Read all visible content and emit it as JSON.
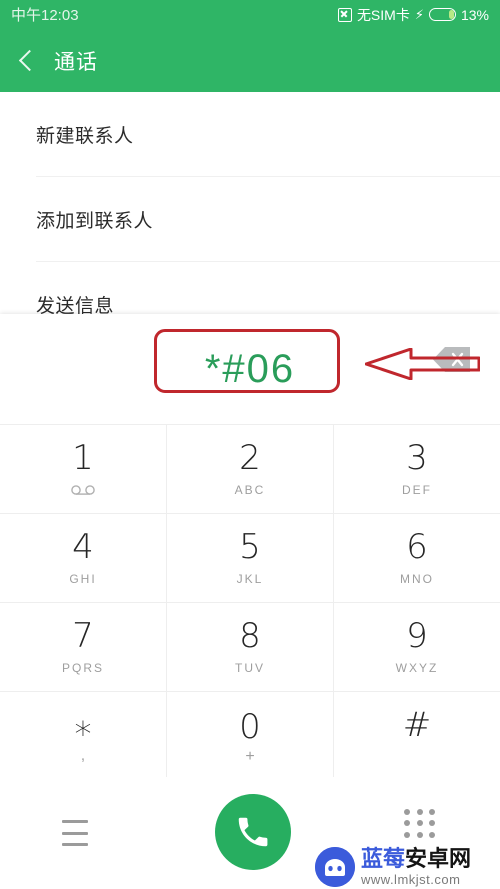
{
  "status_bar": {
    "time": "中午12:03",
    "sim_icon": "sim-card-disabled-icon",
    "sim_text": "无SIM卡",
    "charging_icon": "lightning-bolt-icon",
    "battery_percent": "13%",
    "battery_level": 13
  },
  "header": {
    "back_icon": "chevron-left-icon",
    "title": "通话",
    "background_color": "#2fb566"
  },
  "menu": {
    "items": [
      {
        "label": "新建联系人"
      },
      {
        "label": "添加到联系人"
      },
      {
        "label": "发送信息"
      }
    ]
  },
  "dialer": {
    "number": "*#06",
    "number_color": "#2a9d5a",
    "backspace_icon": "backspace-delete-icon",
    "keys": [
      {
        "digit": "1",
        "sub": "",
        "sub_icon": "voicemail-icon"
      },
      {
        "digit": "2",
        "sub": "ABC",
        "sub_icon": ""
      },
      {
        "digit": "3",
        "sub": "DEF",
        "sub_icon": ""
      },
      {
        "digit": "4",
        "sub": "GHI",
        "sub_icon": ""
      },
      {
        "digit": "5",
        "sub": "JKL",
        "sub_icon": ""
      },
      {
        "digit": "6",
        "sub": "MNO",
        "sub_icon": ""
      },
      {
        "digit": "7",
        "sub": "PQRS",
        "sub_icon": ""
      },
      {
        "digit": "8",
        "sub": "TUV",
        "sub_icon": ""
      },
      {
        "digit": "9",
        "sub": "WXYZ",
        "sub_icon": ""
      },
      {
        "digit": "∗",
        "sub": ",",
        "sub_icon": ""
      },
      {
        "digit": "0",
        "sub": "+",
        "sub_icon": ""
      },
      {
        "digit": "#",
        "sub": "",
        "sub_icon": ""
      }
    ]
  },
  "bottom_bar": {
    "menu_icon": "hamburger-menu-icon",
    "call_icon": "phone-handset-icon",
    "call_button_color": "#27ae60",
    "keypad_icon": "keypad-dots-icon"
  },
  "annotations": {
    "highlight_box_color": "#c0272d",
    "arrow_color": "#c0272d",
    "arrow_target": "backspace-delete-icon"
  },
  "watermark": {
    "logo_icon": "android-robot-logo-icon",
    "name_blue": "蓝莓",
    "name_black": "安卓网",
    "url": "www.lmkjst.com",
    "brand_color": "#3b5bdb"
  }
}
